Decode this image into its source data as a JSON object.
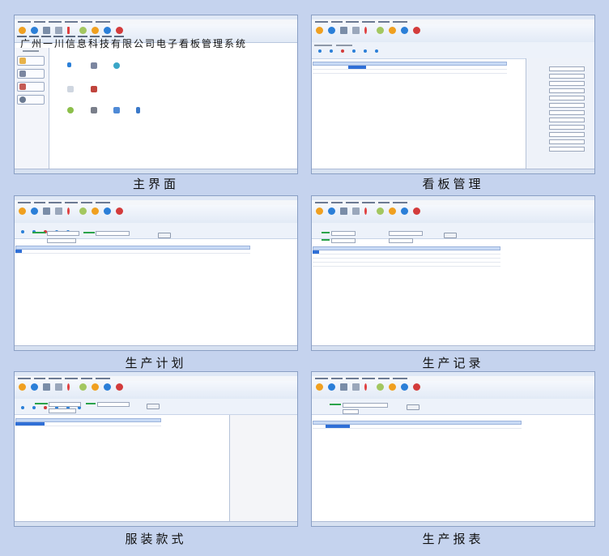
{
  "colors": {
    "background": "#c5d3ee",
    "caption_text": "#111111",
    "selection_blue": "#2f6fd6",
    "toolbar_orange": "#f0a020",
    "toolbar_blue": "#2b7fd8",
    "toolbar_red": "#d33b3b"
  },
  "main_screen": {
    "app_title": "广州一川信息科技有限公司电子看板管理系统"
  },
  "captions": {
    "main": "主界面",
    "kanban": "看板管理",
    "plan": "生产计划",
    "record": "生产记录",
    "style": "服装款式",
    "report": "生产报表"
  }
}
